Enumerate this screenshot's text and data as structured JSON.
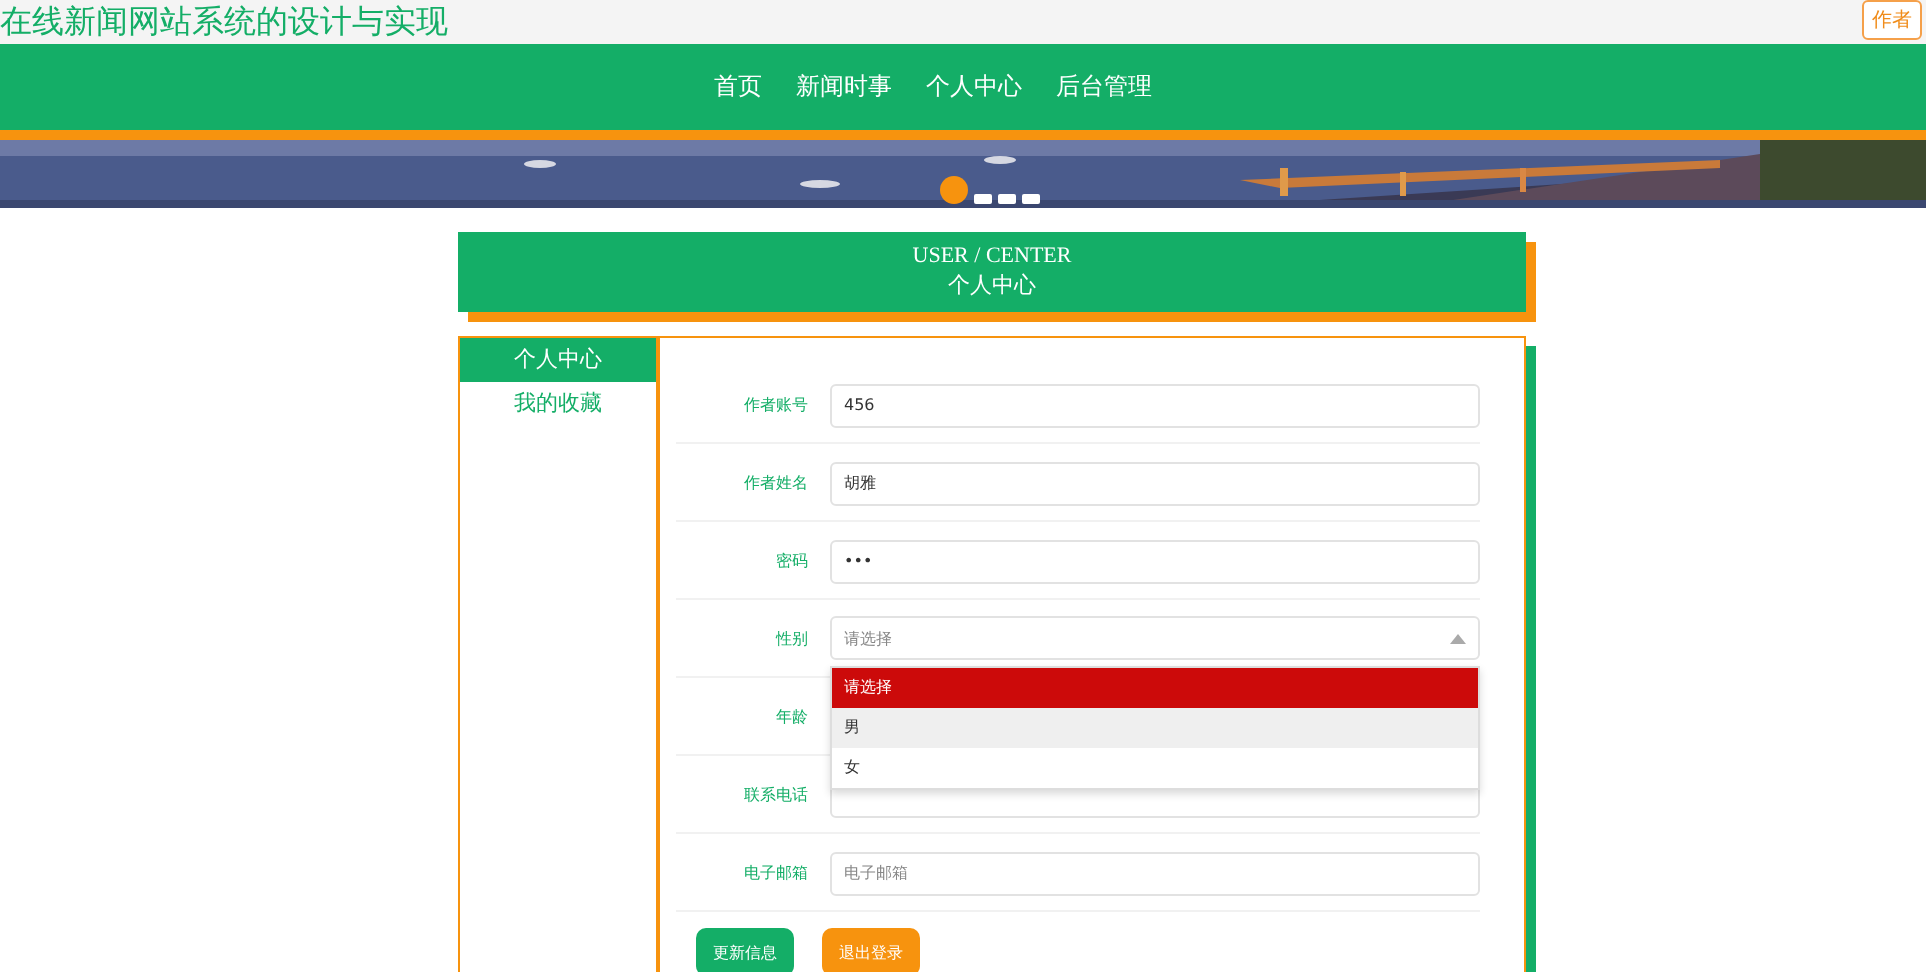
{
  "site_title": "在线新闻网站系统的设计与实现",
  "corner_button": "作者",
  "nav": [
    {
      "label": "首页",
      "selected": false
    },
    {
      "label": "新闻时事",
      "selected": false
    },
    {
      "label": "个人中心",
      "selected": false
    },
    {
      "label": "后台管理",
      "selected": false
    }
  ],
  "banner": {
    "kind": "picture",
    "dots": [
      {
        "selected": true
      },
      {
        "selected": false
      },
      {
        "selected": false
      },
      {
        "selected": false
      }
    ]
  },
  "header": {
    "title_en": "USER / CENTER",
    "title_cn": "个人中心"
  },
  "sidebar": [
    {
      "label": "个人中心",
      "selected": true
    },
    {
      "label": "我的收藏",
      "selected": false
    }
  ],
  "form": [
    {
      "label": "作者账号",
      "kind": "input",
      "value": "456"
    },
    {
      "label": "作者姓名",
      "kind": "input",
      "value": "胡雅"
    },
    {
      "label": "密码",
      "kind": "input",
      "value": "•••"
    },
    {
      "label": "性别",
      "kind": "select",
      "placeholder": "请选择",
      "open": true,
      "options": [
        {
          "label": "请选择",
          "selected": true,
          "hovered": false
        },
        {
          "label": "男",
          "selected": false,
          "hovered": true
        },
        {
          "label": "女",
          "selected": false,
          "hovered": false
        }
      ]
    },
    {
      "label": "年龄",
      "kind": "hidden"
    },
    {
      "label": "联系电话",
      "kind": "input"
    },
    {
      "label": "电子邮箱",
      "kind": "input",
      "placeholder": "电子邮箱"
    }
  ],
  "buttons": [
    {
      "label": "更新信息",
      "kind": "primary"
    },
    {
      "label": "退出登录",
      "kind": "warning"
    }
  ]
}
